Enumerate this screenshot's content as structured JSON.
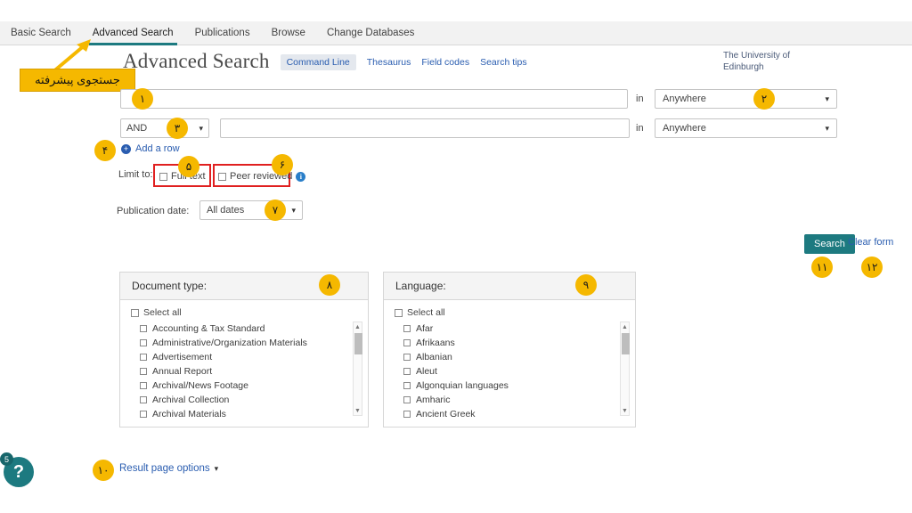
{
  "topnav": {
    "items": [
      {
        "label": "Basic Search",
        "active": false
      },
      {
        "label": "Advanced Search",
        "active": true
      },
      {
        "label": "Publications",
        "active": false
      },
      {
        "label": "Browse",
        "active": false
      },
      {
        "label": "Change Databases",
        "active": false
      }
    ]
  },
  "header": {
    "title": "Advanced Search",
    "command_line": "Command Line",
    "links": [
      "Thesaurus",
      "Field codes",
      "Search tips"
    ],
    "university": "The University of\nEdinburgh",
    "university_line1": "The University of",
    "university_line2": "Edinburgh"
  },
  "annotation": {
    "callout_text": "جستجوی پیشرفته"
  },
  "form": {
    "row1": {
      "query_value": "",
      "query_placeholder": "",
      "in_label": "in",
      "field_value": "Anywhere"
    },
    "row2": {
      "boolean_value": "AND",
      "query_value": "",
      "query_placeholder": "",
      "in_label": "in",
      "field_value": "Anywhere"
    },
    "add_row_label": "Add a row",
    "limit_to_label": "Limit to:",
    "full_text_label": "Full text",
    "peer_reviewed_label": "Peer reviewed",
    "info_icon_char": "i",
    "publication_date_label": "Publication date:",
    "publication_date_value": "All dates",
    "search_button": "Search",
    "clear_form": "Clear form"
  },
  "facets": {
    "document_type": {
      "heading": "Document type:",
      "select_all": "Select all",
      "items": [
        "Accounting & Tax Standard",
        "Administrative/Organization Materials",
        "Advertisement",
        "Annual Report",
        "Archival/News Footage",
        "Archival Collection",
        "Archival Materials"
      ]
    },
    "language": {
      "heading": "Language:",
      "select_all": "Select all",
      "items": [
        "Afar",
        "Afrikaans",
        "Albanian",
        "Aleut",
        "Algonquian languages",
        "Amharic",
        "Ancient Greek"
      ]
    }
  },
  "footer": {
    "help_char": "?",
    "help_badge": "5",
    "result_page_options": "Result page options"
  },
  "markers": {
    "m1": "١",
    "m2": "٢",
    "m3": "٣",
    "m4": "۴",
    "m5": "۵",
    "m6": "۶",
    "m7": "٧",
    "m8": "٨",
    "m9": "٩",
    "m10": "١٠",
    "m11": "١١",
    "m12": "١٢"
  },
  "colors": {
    "accent_teal": "#1d7a80",
    "marker_yellow": "#f5b800",
    "link_blue": "#2a5db0",
    "highlight_red": "#e02020"
  }
}
